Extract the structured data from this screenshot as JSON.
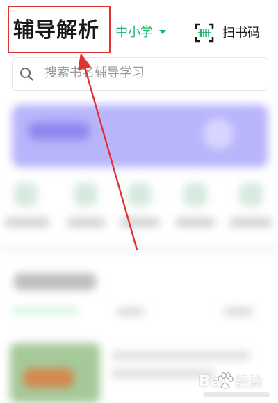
{
  "header": {
    "title": "辅导解析",
    "grade_selector": "中小学",
    "scan_label": "扫书码"
  },
  "search": {
    "placeholder": "搜索书名辅导学习"
  },
  "watermark": {
    "brand": "Bai",
    "brand_suffix": "经验"
  },
  "colors": {
    "accent_green": "#1bb46a",
    "annotation_red": "#e03232",
    "banner_purple": "#b9b5fb"
  },
  "icons": {
    "scan": "scan-barcode-icon",
    "search": "search-icon",
    "grade_dropdown": "caret-down-icon"
  }
}
